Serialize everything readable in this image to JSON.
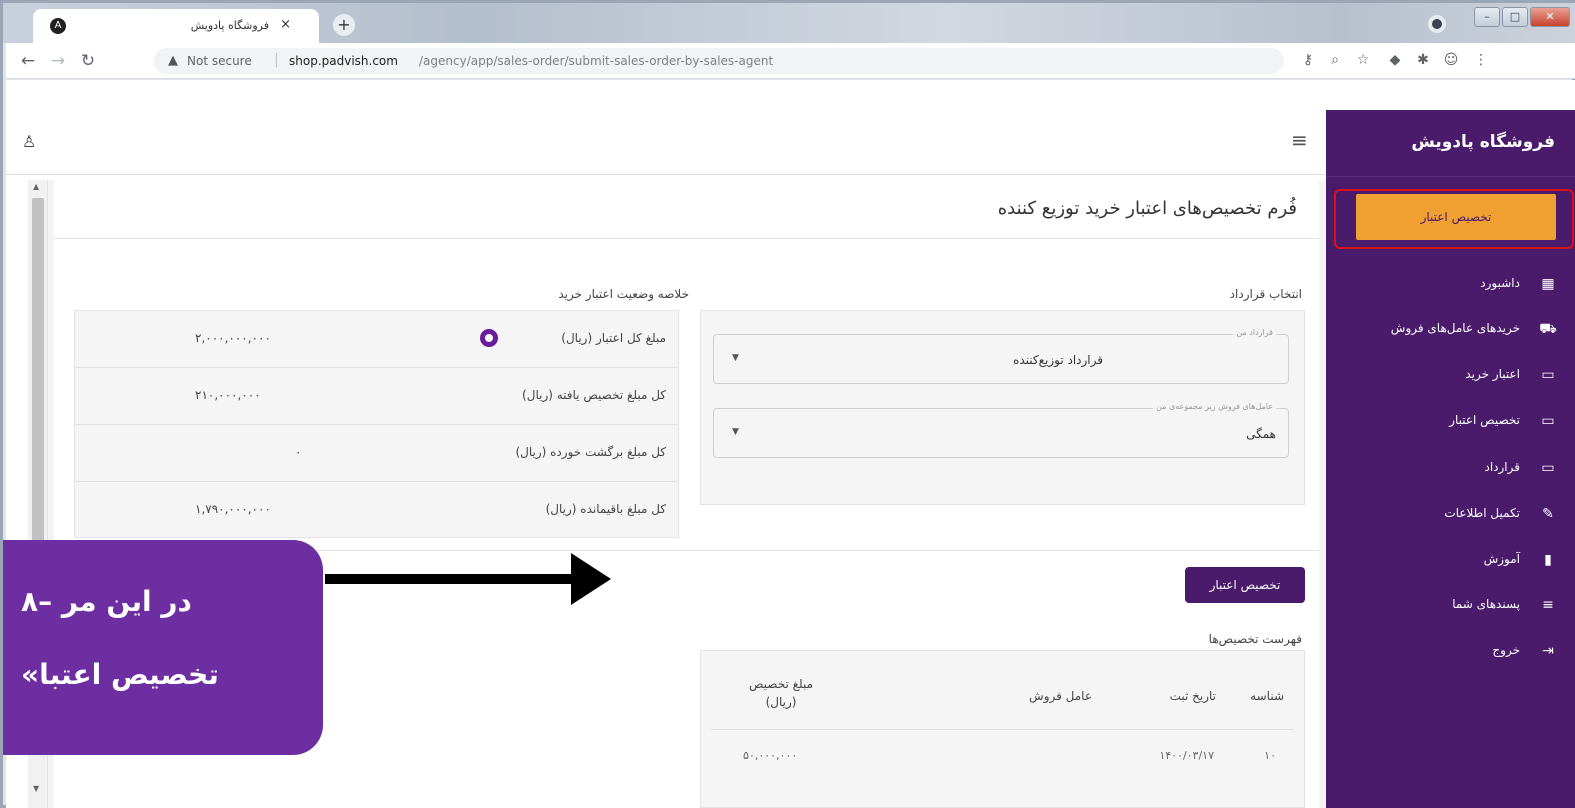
{
  "browser": {
    "tab_title": "فروشگاه پادویش",
    "tab_close": "×",
    "new_tab": "+",
    "security_label": "Not secure",
    "url_host": "shop.padvish.com",
    "url_path": "/agency/app/sales-order/submit-sales-order-by-sales-agent"
  },
  "header": {},
  "sidebar": {
    "brand": "فروشگاه پادویش",
    "active_button": "تخصیص اعتبار",
    "items": [
      {
        "label": "داشبورد",
        "icon": "dashboard-icon"
      },
      {
        "label": "خریدهای عامل‌های فروش",
        "icon": "cart-icon"
      },
      {
        "label": "اعتبار خرید",
        "icon": "card-icon"
      },
      {
        "label": "تخصیص اعتبار",
        "icon": "card-icon"
      },
      {
        "label": "قرارداد",
        "icon": "card-icon"
      },
      {
        "label": "تکمیل اطلاعات",
        "icon": "pencil-icon"
      },
      {
        "label": "آموزش",
        "icon": "book-icon"
      },
      {
        "label": "پسندهای شما",
        "icon": "playlist-icon"
      },
      {
        "label": "خروج",
        "icon": "logout-icon"
      }
    ]
  },
  "form": {
    "title": "فُرم تخصیص‌های اعتبار خرید توزیع کننده"
  },
  "summary": {
    "title": "خلاصه وضعیت اعتبار خرید",
    "rows": [
      {
        "label": "مبلغ کل اعتبار (ریال)",
        "value": "۲,۰۰۰,۰۰۰,۰۰۰"
      },
      {
        "label": "کل مبلغ تخصیص یافته (ریال)",
        "value": "۲۱۰,۰۰۰,۰۰۰"
      },
      {
        "label": "کل مبلغ برگشت خورده (ریال)",
        "value": "۰"
      },
      {
        "label": "کل مبلغ باقیمانده (ریال)",
        "value": "۱,۷۹۰,۰۰۰,۰۰۰"
      }
    ]
  },
  "contract": {
    "title": "انتخاب قرارداد",
    "contract_field_legend": "قرارداد من",
    "contract_field_value": "قرارداد توزیع‌کننده",
    "agents_field_legend": "عامل‌های فروش زیر مجموعه‌ی من",
    "agents_field_value": "همگی"
  },
  "allocate_button": "تخصیص اعتبار",
  "allocations": {
    "title": "فهرست تخصیص‌ها",
    "headers": {
      "id": "شناسه",
      "date": "تاریخ ثبت",
      "agent": "عامل فروش",
      "amount_line1": "مبلغ تخصیص",
      "amount_line2": "(ریال)"
    },
    "rows": [
      {
        "id": "۱۰",
        "date": "۱۴۰۰/۰۳/۱۷",
        "agent": "",
        "amount": "۵۰,۰۰۰,۰۰۰"
      }
    ]
  },
  "callout": {
    "line1": "۸– در این مر",
    "line2": "«تخصیص اعتبا"
  }
}
